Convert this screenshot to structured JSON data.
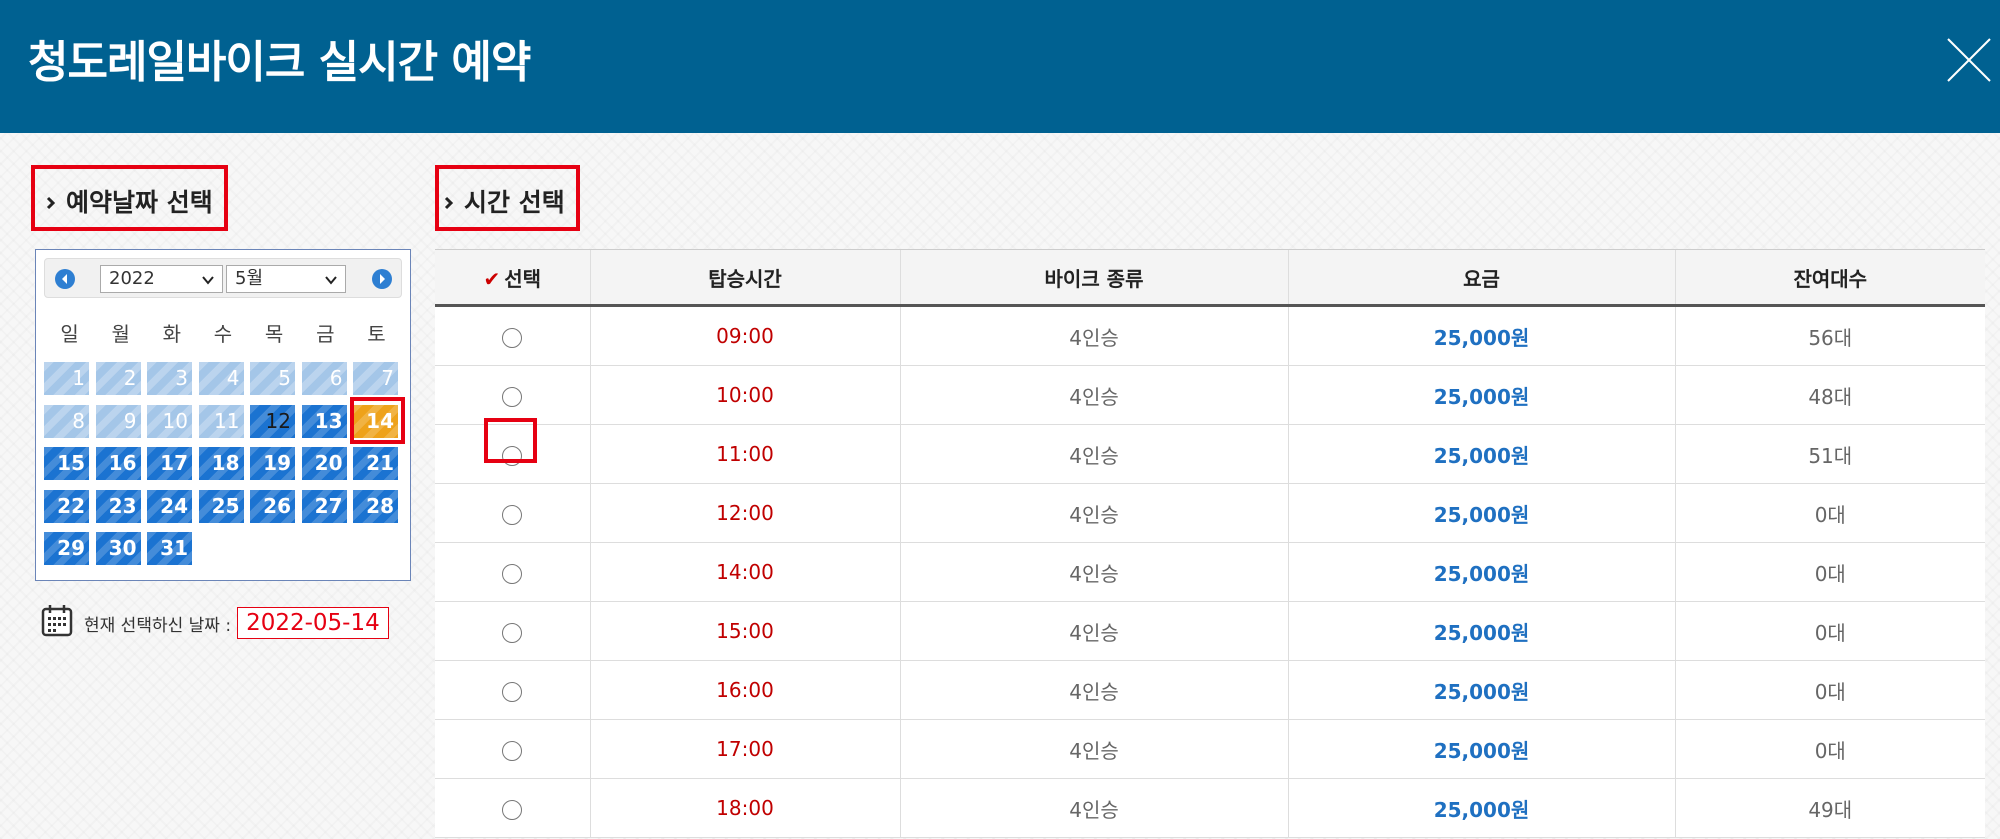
{
  "header": {
    "title": "청도레일바이크 실시간 예약"
  },
  "date_section": {
    "title": "예약날짜 선택"
  },
  "time_section": {
    "title": "시간 선택"
  },
  "calendar": {
    "year": "2022",
    "month": "5월",
    "weekdays": [
      "일",
      "월",
      "화",
      "수",
      "목",
      "금",
      "토"
    ],
    "days": [
      "1",
      "2",
      "3",
      "4",
      "5",
      "6",
      "7",
      "8",
      "9",
      "10",
      "11",
      "12",
      "13",
      "14",
      "15",
      "16",
      "17",
      "18",
      "19",
      "20",
      "21",
      "22",
      "23",
      "24",
      "25",
      "26",
      "27",
      "28",
      "29",
      "30",
      "31"
    ],
    "past_days": [
      "1",
      "2",
      "3",
      "4",
      "5",
      "6",
      "7",
      "8",
      "9",
      "10",
      "11"
    ],
    "today": "12",
    "selected_day": "14"
  },
  "current_date": {
    "label": "현재 선택하신 날짜 :",
    "value": "2022-05-14"
  },
  "table": {
    "headers": [
      "선택",
      "탑승시간",
      "바이크 종류",
      "요금",
      "잔여대수"
    ],
    "rows": [
      {
        "time": "09:00",
        "kind": "4인승",
        "fee": "25,000원",
        "remaining": "56대"
      },
      {
        "time": "10:00",
        "kind": "4인승",
        "fee": "25,000원",
        "remaining": "48대"
      },
      {
        "time": "11:00",
        "kind": "4인승",
        "fee": "25,000원",
        "remaining": "51대"
      },
      {
        "time": "12:00",
        "kind": "4인승",
        "fee": "25,000원",
        "remaining": "0대"
      },
      {
        "time": "14:00",
        "kind": "4인승",
        "fee": "25,000원",
        "remaining": "0대"
      },
      {
        "time": "15:00",
        "kind": "4인승",
        "fee": "25,000원",
        "remaining": "0대"
      },
      {
        "time": "16:00",
        "kind": "4인승",
        "fee": "25,000원",
        "remaining": "0대"
      },
      {
        "time": "17:00",
        "kind": "4인승",
        "fee": "25,000원",
        "remaining": "0대"
      },
      {
        "time": "18:00",
        "kind": "4인승",
        "fee": "25,000원",
        "remaining": "49대"
      }
    ]
  },
  "colors": {
    "header_bg": "#006191",
    "highlight": "#e60012",
    "day_active": "#1b73d1",
    "day_past": "#a4c6e8",
    "day_selected": "#eea21a",
    "time_text": "#c00000",
    "fee_text": "#1f70c1"
  }
}
